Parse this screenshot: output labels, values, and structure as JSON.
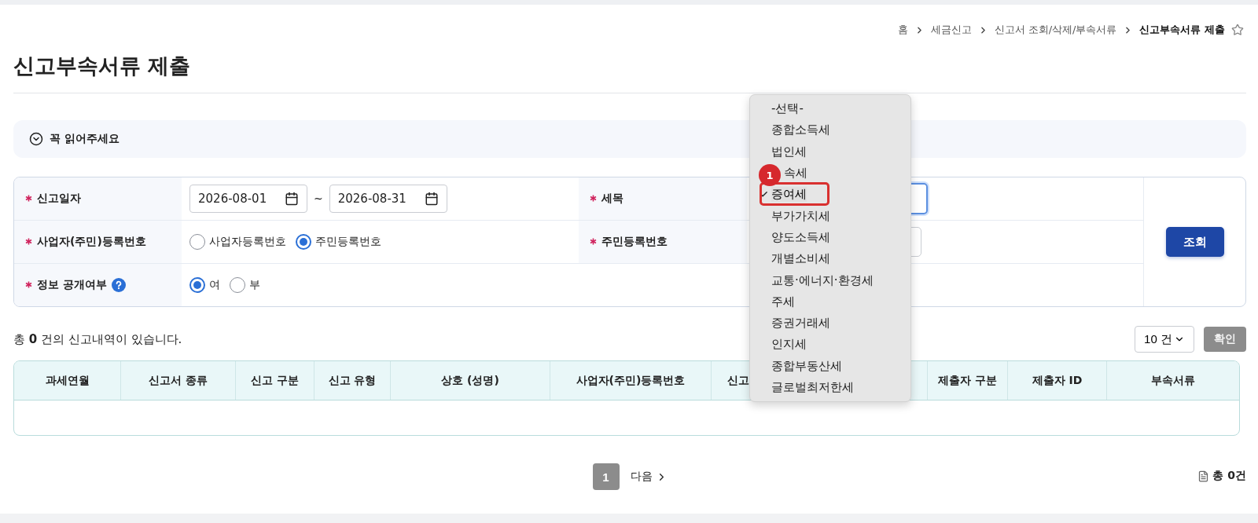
{
  "breadcrumb": [
    {
      "label": "홈",
      "current": false
    },
    {
      "label": "세금신고",
      "current": false
    },
    {
      "label": "신고서 조회/삭제/부속서류",
      "current": false
    },
    {
      "label": "신고부속서류 제출",
      "current": true
    }
  ],
  "title": "신고부속서류 제출",
  "notice": {
    "label": "꼭 읽어주세요"
  },
  "form": {
    "report_date": {
      "label": "신고일자",
      "from": "2026-08-01",
      "to": "2026-08-31",
      "separator": "~"
    },
    "tax_item": {
      "label": "세목",
      "focused": true
    },
    "reg_number_type": {
      "label": "사업자(주민)등록번호",
      "options": [
        {
          "label": "사업자등록번호",
          "selected": false
        },
        {
          "label": "주민등록번호",
          "selected": true
        }
      ]
    },
    "resident_number": {
      "label": "주민등록번호"
    },
    "disclosure": {
      "label": "정보 공개여부",
      "options": [
        {
          "label": "여",
          "selected": true
        },
        {
          "label": "부",
          "selected": false
        }
      ]
    },
    "search_button": "조회"
  },
  "dropdown": {
    "items": [
      {
        "label": "-선택-",
        "selected": false
      },
      {
        "label": "종합소득세",
        "selected": false
      },
      {
        "label": "법인세",
        "selected": false
      },
      {
        "label": "속세",
        "selected": false
      },
      {
        "label": "증여세",
        "selected": true
      },
      {
        "label": "부가가치세",
        "selected": false
      },
      {
        "label": "양도소득세",
        "selected": false
      },
      {
        "label": "개별소비세",
        "selected": false
      },
      {
        "label": "교통·에너지·환경세",
        "selected": false
      },
      {
        "label": "주세",
        "selected": false
      },
      {
        "label": "증권거래세",
        "selected": false
      },
      {
        "label": "인지세",
        "selected": false
      },
      {
        "label": "종합부동산세",
        "selected": false
      },
      {
        "label": "글로벌최저한세",
        "selected": false
      }
    ],
    "annotation": "1"
  },
  "results": {
    "summary": "총 **0** 건의 신고내역이 있습니다.",
    "page_size": "10 건",
    "confirm_button": "확인"
  },
  "table": {
    "columns": [
      "과세연월",
      "신고서 종류",
      "신고 구분",
      "신고 유형",
      "상호 (성명)",
      "사업자(주민)등록번호",
      "신고",
      "제출자 구분",
      "제출자 ID",
      "부속서류"
    ]
  },
  "pagination": {
    "pages": [
      {
        "label": "1",
        "selected": true
      }
    ],
    "next": "다음"
  },
  "total": "총 0건"
}
